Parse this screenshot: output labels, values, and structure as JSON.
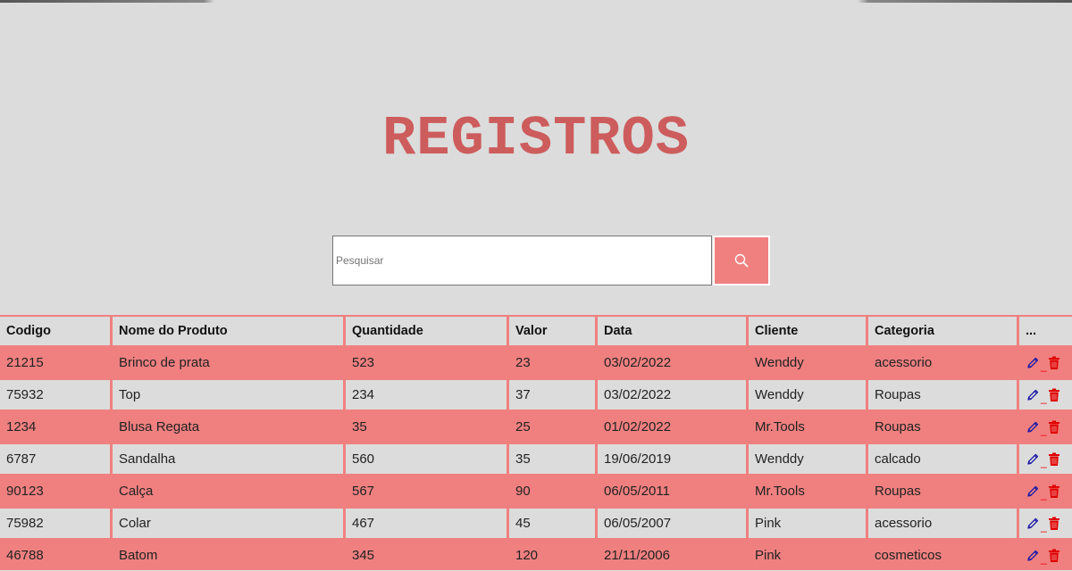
{
  "page": {
    "title": "REGISTROS"
  },
  "search": {
    "placeholder": "Pesquisar",
    "value": "",
    "icon": "search-icon"
  },
  "colors": {
    "accent": "#f08080",
    "title": "#cd5c5c",
    "background": "#dcdcdc",
    "edit_icon": "#1a1aa6",
    "delete_icon": "#e00000"
  },
  "table": {
    "columns": [
      "Codigo",
      "Nome do Produto",
      "Quantidade",
      "Valor",
      "Data",
      "Cliente",
      "Categoria",
      "..."
    ],
    "action_separator": "_",
    "rows": [
      [
        "21215",
        "Brinco de prata",
        "523",
        "23",
        "03/02/2022",
        "Wenddy",
        "acessorio"
      ],
      [
        "75932",
        "Top",
        "234",
        "37",
        "03/02/2022",
        "Wenddy",
        "Roupas"
      ],
      [
        "1234",
        "Blusa Regata",
        "35",
        "25",
        "01/02/2022",
        "Mr.Tools",
        "Roupas"
      ],
      [
        "6787",
        "Sandalha",
        "560",
        "35",
        "19/06/2019",
        "Wenddy",
        "calcado"
      ],
      [
        "90123",
        "Calça",
        "567",
        "90",
        "06/05/2011",
        "Mr.Tools",
        "Roupas"
      ],
      [
        "75982",
        "Colar",
        "467",
        "45",
        "06/05/2007",
        "Pink",
        "acessorio"
      ],
      [
        "46788",
        "Batom",
        "345",
        "120",
        "21/11/2006",
        "Pink",
        "cosmeticos"
      ]
    ]
  }
}
